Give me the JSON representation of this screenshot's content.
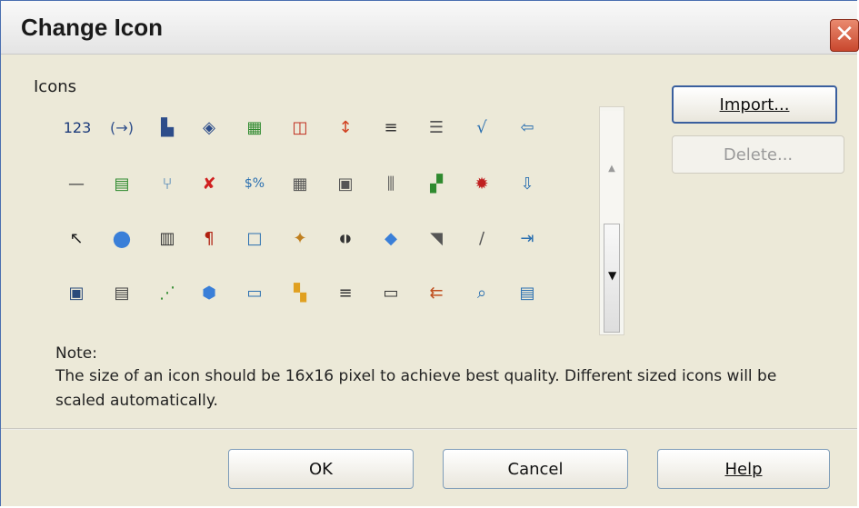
{
  "window": {
    "title": "Change Icon",
    "close_glyph": "✕"
  },
  "icons_group": {
    "label": "Icons",
    "rows": [
      [
        "123",
        "(→)",
        "▙",
        "◈",
        "▦",
        "◫",
        "↕",
        "≡",
        "☰",
        "√",
        "⇦"
      ],
      [
        "—",
        "▤",
        "⑂",
        "✘",
        "$%",
        "▦",
        "▣",
        "⫼",
        "▞",
        "✹",
        "⇩"
      ],
      [
        "↖",
        "●",
        "▥",
        "¶",
        "□",
        "✦",
        "◖◗",
        "◆",
        "◥",
        "∕",
        "⇥"
      ],
      [
        "▣",
        "▤",
        "⋰",
        "⬢",
        "▭",
        "▚",
        "≡",
        "▭",
        "⇇",
        "⌕",
        "▤"
      ]
    ]
  },
  "buttons": {
    "import": "Import...",
    "delete": "Delete...",
    "ok": "OK",
    "cancel": "Cancel",
    "help": "Help"
  },
  "note": {
    "label": "Note:",
    "text": "The size of an icon should be 16x16 pixel to achieve best quality. Different sized icons will be scaled automatically."
  },
  "colors": {
    "titlebar": "#ececec",
    "dialog_bg": "#ece9d8",
    "button_border": "#7f9db9",
    "close_button": "#c9472e"
  }
}
